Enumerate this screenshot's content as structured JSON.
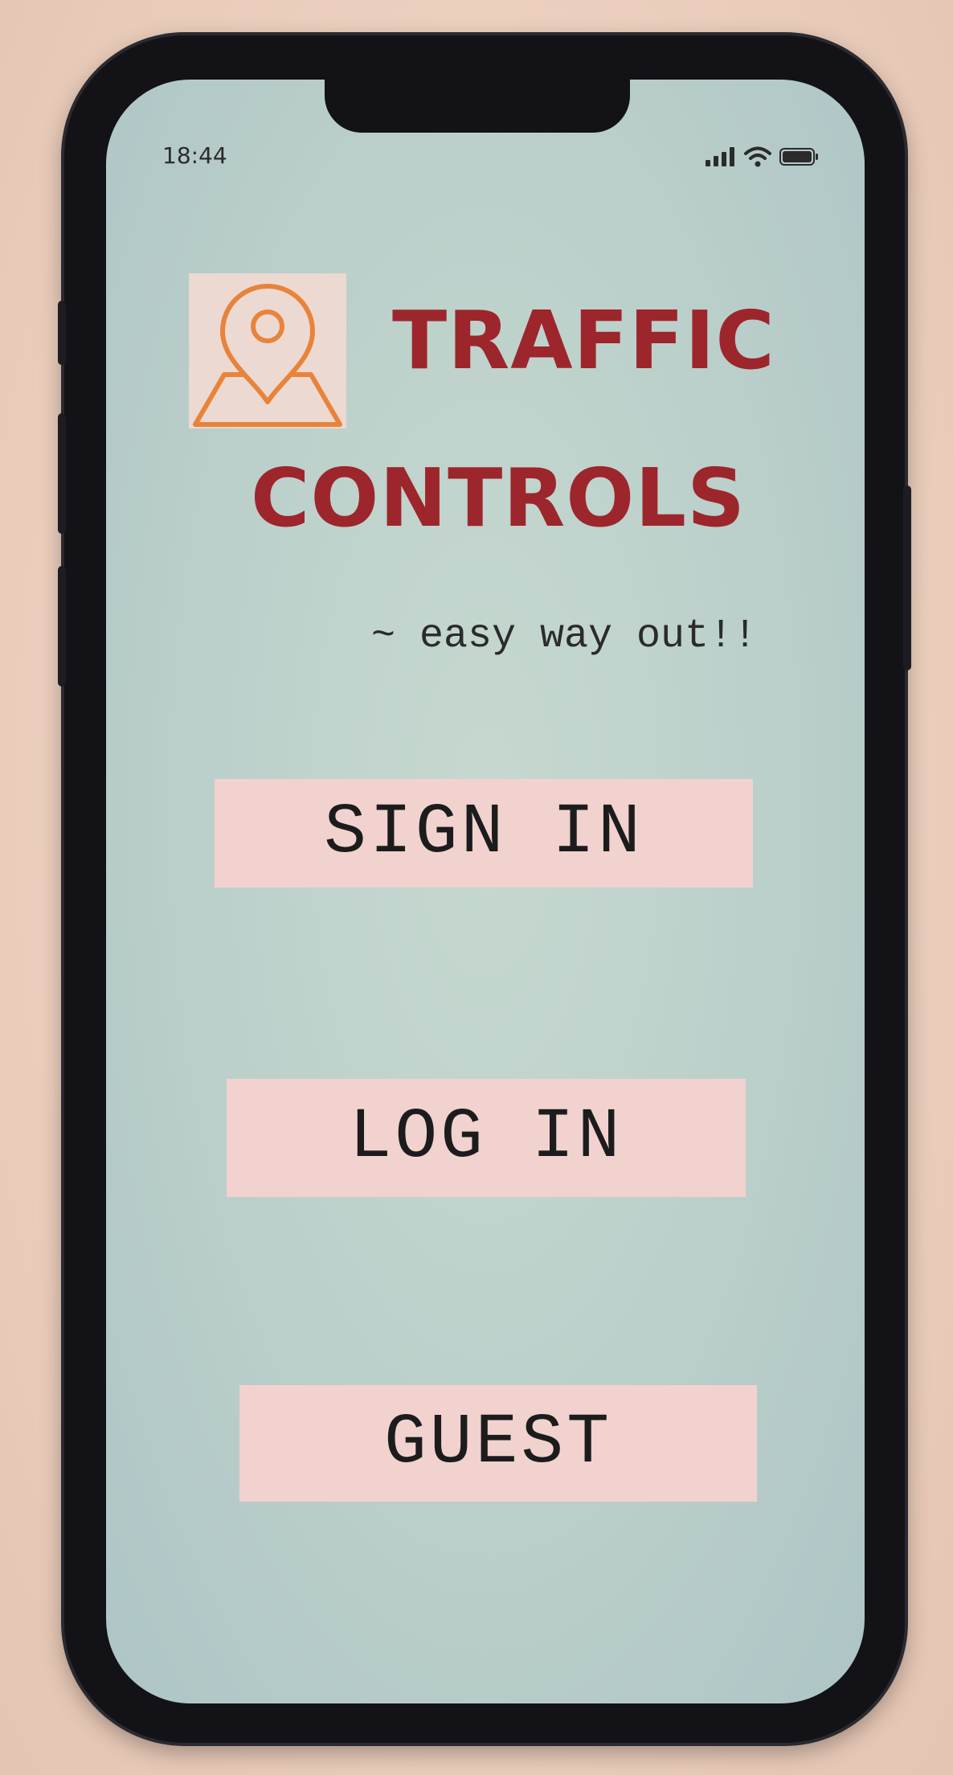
{
  "status_bar": {
    "time": "18:44",
    "icons": [
      "signal-icon",
      "wifi-icon",
      "battery-icon"
    ]
  },
  "app": {
    "logo_icon": "map-pin-icon",
    "title_line1": "TRAFFIC",
    "title_line2": "CONTROLS",
    "tagline": "~ easy way out!!"
  },
  "buttons": {
    "sign_in": "SIGN IN",
    "log_in": "LOG IN",
    "guest": "GUEST"
  },
  "colors": {
    "title": "#9c262c",
    "logo_stroke": "#e8833a",
    "button_bg": "#f1d2ce",
    "screen_bg": "#bcd0cb"
  }
}
